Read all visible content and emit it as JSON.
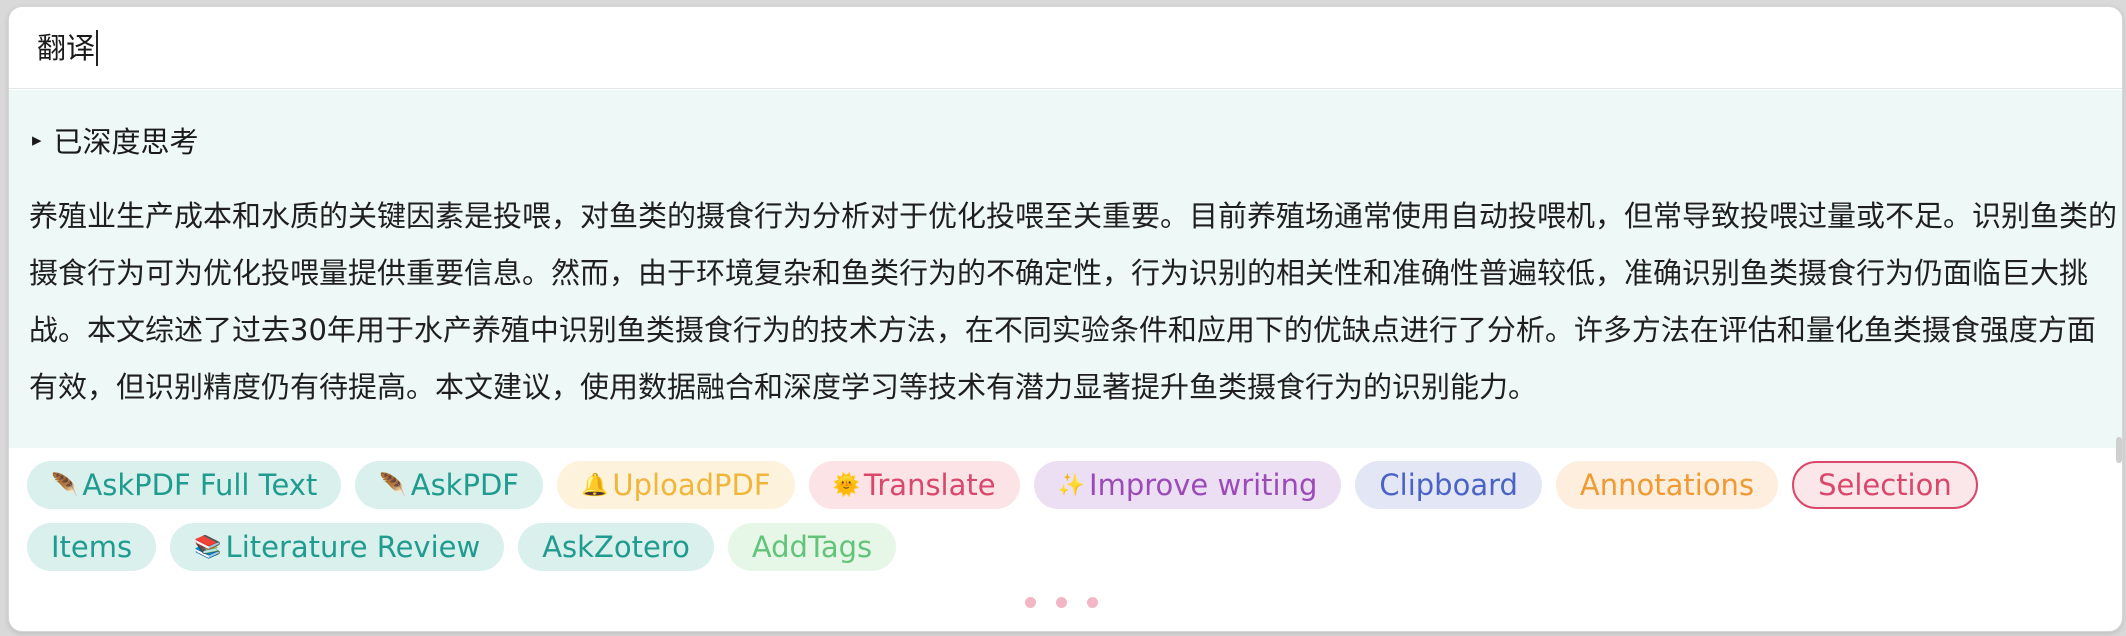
{
  "input": {
    "value": "翻译"
  },
  "thought": {
    "icon": "triangle-right-icon",
    "label": "已深度思考"
  },
  "answer": {
    "text": "养殖业生产成本和水质的关键因素是投喂，对鱼类的摄食行为分析对于优化投喂至关重要。目前养殖场通常使用自动投喂机，但常导致投喂过量或不足。识别鱼类的摄食行为可为优化投喂量提供重要信息。然而，由于环境复杂和鱼类行为的不确定性，行为识别的相关性和准确性普遍较低，准确识别鱼类摄食行为仍面临巨大挑战。本文综述了过去30年用于水产养殖中识别鱼类摄食行为的技术方法，在不同实验条件和应用下的优缺点进行了分析。许多方法在评估和量化鱼类摄食强度方面有效，但识别精度仍有待提高。本文建议，使用数据融合和深度学习等技术有潜力显著提升鱼类摄食行为的识别能力。"
  },
  "tags": [
    {
      "emoji": "🪶",
      "label": "AskPDF Full Text",
      "style": "teal"
    },
    {
      "emoji": "🪶",
      "label": "AskPDF",
      "style": "teal"
    },
    {
      "emoji": "🔔",
      "label": "UploadPDF",
      "style": "yellow"
    },
    {
      "emoji": "🌞",
      "label": "Translate",
      "style": "pink"
    },
    {
      "emoji": "✨",
      "label": "Improve writing",
      "style": "purple"
    },
    {
      "emoji": "",
      "label": "Clipboard",
      "style": "blue"
    },
    {
      "emoji": "",
      "label": "Annotations",
      "style": "orange"
    },
    {
      "emoji": "",
      "label": "Selection",
      "style": "select"
    },
    {
      "emoji": "",
      "label": "Items",
      "style": "teal"
    },
    {
      "emoji": "📚",
      "label": "Literature Review",
      "style": "teal"
    },
    {
      "emoji": "",
      "label": "AskZotero",
      "style": "teal"
    },
    {
      "emoji": "",
      "label": "AddTags",
      "style": "green"
    }
  ],
  "pager": {
    "icon": "ellipsis-dots-icon"
  },
  "colors": {
    "answer_bg": "#eef8f6",
    "teal": "#1f9b8f",
    "pink": "#d9476a",
    "purple": "#9b4bb8",
    "blue": "#4a63c4",
    "orange": "#f09a33",
    "yellow": "#f2b53b",
    "green": "#62c47a"
  }
}
